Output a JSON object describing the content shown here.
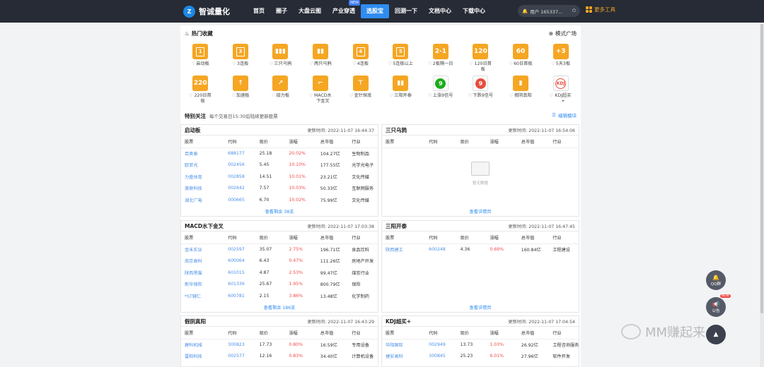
{
  "header": {
    "logo_mark": "Z",
    "logo_text": "智诚量化",
    "nav": [
      {
        "label": "首页"
      },
      {
        "label": "圈子"
      },
      {
        "label": "大盘云图"
      },
      {
        "label": "产业穿透",
        "badge": "NEW"
      },
      {
        "label": "选股宝",
        "active": true
      },
      {
        "label": "回测一下"
      },
      {
        "label": "文档中心"
      },
      {
        "label": "下载中心"
      }
    ],
    "user_label": "用户 165337...",
    "more_tools": "更多工具"
  },
  "hot": {
    "title": "热门收藏",
    "plaza": "模式广场",
    "cards": [
      {
        "icon": "1",
        "style": "box",
        "label": "启动板"
      },
      {
        "icon": "3",
        "style": "box",
        "label": "3连板"
      },
      {
        "icon": "▮▮▮",
        "style": "plain",
        "label": "三只乌鸦"
      },
      {
        "icon": "▮▮",
        "style": "plain",
        "label": "两只乌鸦"
      },
      {
        "icon": "4",
        "style": "box",
        "label": "4连板"
      },
      {
        "icon": "5",
        "style": "box",
        "label": "5连板以上"
      },
      {
        "icon": "2-1",
        "style": "plain",
        "label": "2板隔一日"
      },
      {
        "icon": "120",
        "style": "plain",
        "label": "120日首板"
      },
      {
        "icon": "60",
        "style": "plain",
        "label": "60日首板"
      },
      {
        "icon": "+3",
        "style": "plain",
        "label": "5天3板"
      },
      {
        "icon": "220",
        "style": "plain",
        "label": "220日首板"
      },
      {
        "icon": "↑",
        "style": "plain",
        "label": "加速板"
      },
      {
        "icon": "↗",
        "style": "plain",
        "label": "接力板"
      },
      {
        "icon": "⌐",
        "style": "plain",
        "label": "MACD水下金叉"
      },
      {
        "icon": "⊤",
        "style": "plain",
        "label": "金针探底"
      },
      {
        "icon": "▮▮",
        "style": "plain",
        "label": "三阳开泰"
      },
      {
        "icon": "9",
        "style": "green",
        "label": "上涨9信号"
      },
      {
        "icon": "9",
        "style": "red",
        "label": "下跌9信号"
      },
      {
        "icon": "▮",
        "style": "plain",
        "label": "假阴真阳"
      },
      {
        "icon": "KDJ",
        "style": "redring",
        "label": "KDJ超买+"
      }
    ]
  },
  "focus": {
    "title": "特别关注",
    "subtitle": "每个交易日15:30后陆续更新股票",
    "edit": "编辑模块"
  },
  "columns": [
    "股票",
    "代码",
    "现价",
    "涨幅",
    "总市值",
    "行业"
  ],
  "panels": [
    {
      "title": "启动板",
      "time": "更新时间: 2022-11-07 16:44:37",
      "rows": [
        [
          "百奥泰",
          "688177",
          "25.18",
          "20.02%",
          "104.27亿",
          "生物制品"
        ],
        [
          "欧菲光",
          "002456",
          "5.45",
          "10.10%",
          "177.55亿",
          "光学光电子"
        ],
        [
          "力盛体育",
          "002858",
          "14.51",
          "10.01%",
          "23.21亿",
          "文化传媒"
        ],
        [
          "美联科技",
          "002642",
          "7.57",
          "10.03%",
          "50.33亿",
          "互联网服务"
        ],
        [
          "湖北广电",
          "000665",
          "6.70",
          "10.02%",
          "75.99亿",
          "文化传媒"
        ]
      ],
      "more": "查看剩余 38支"
    },
    {
      "title": "三只乌鸦",
      "time": "更新时间: 2022-11-07 16:54:06",
      "rows": [],
      "empty": "暂无数据",
      "more": "查看详情页"
    },
    {
      "title": "MACD水下金叉",
      "time": "更新时间: 2022-11-07 17:03:38",
      "rows": [
        [
          "金禾实业",
          "002597",
          "35.07",
          "2.75%",
          "196.71亿",
          "食品饮料"
        ],
        [
          "南京高科",
          "600064",
          "6.43",
          "0.47%",
          "111.26亿",
          "房地产开发"
        ],
        [
          "陕西黑猫",
          "601015",
          "4.87",
          "2.53%",
          "99.47亿",
          "煤炭行业"
        ],
        [
          "新华保险",
          "601336",
          "25.67",
          "1.95%",
          "800.79亿",
          "保险"
        ],
        [
          "*ST辅仁",
          "600781",
          "2.15",
          "3.86%",
          "13.48亿",
          "化学制药"
        ]
      ],
      "more": "查看剩余 186支"
    },
    {
      "title": "三阳开泰",
      "time": "更新时间: 2022-11-07 16:47:45",
      "rows": [
        [
          "陕西建工",
          "600248",
          "4.36",
          "0.69%",
          "160.84亿",
          "工程建设"
        ]
      ],
      "more": "查看详情页"
    },
    {
      "title": "假阴真阳",
      "time": "更新时间: 2022-11-07 16:43:29",
      "rows": [
        [
          "建科机械",
          "300823",
          "17.73",
          "0.80%",
          "16.59亿",
          "专用设备"
        ],
        [
          "雷柏科技",
          "002577",
          "12.16",
          "0.83%",
          "34.40亿",
          "计算机设备"
        ]
      ],
      "more": ""
    },
    {
      "title": "KDJ超买+",
      "time": "更新时间: 2022-11-07 17:04:54",
      "rows": [
        [
          "华阳国际",
          "002949",
          "13.73",
          "1.03%",
          "26.92亿",
          "工程咨询服务"
        ],
        [
          "捷安高科",
          "300845",
          "25.23",
          "6.01%",
          "27.96亿",
          "软件开发"
        ]
      ],
      "more": ""
    }
  ],
  "floating": {
    "qq": "QQ群",
    "notice": "公告",
    "new_tag": "NEW"
  },
  "watermark": "MM赚起来",
  "colors": {
    "accent": "#2f8cf0",
    "card": "#f5a623",
    "up": "#f04b4b",
    "topbar": "#262b35"
  }
}
